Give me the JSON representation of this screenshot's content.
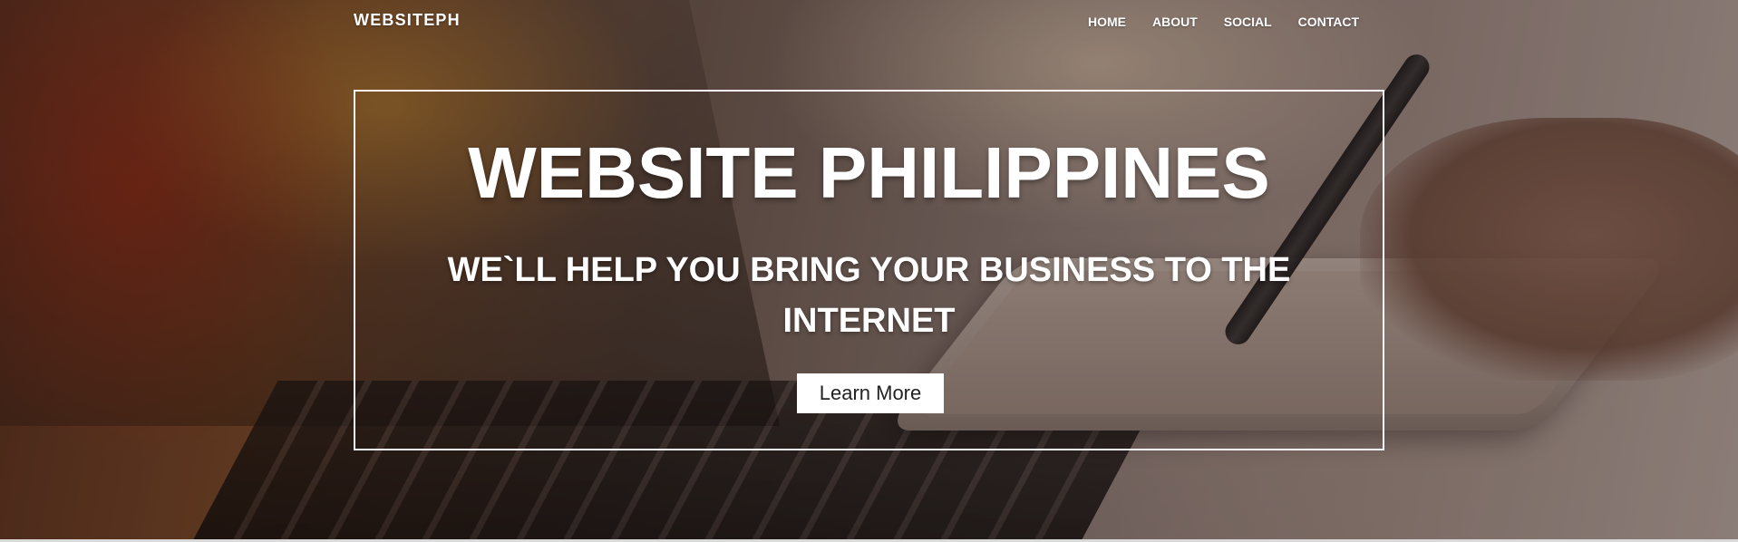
{
  "nav": {
    "brand": "WEBSITEPH",
    "items": [
      {
        "label": "HOME"
      },
      {
        "label": "ABOUT"
      },
      {
        "label": "SOCIAL"
      },
      {
        "label": "CONTACT"
      }
    ]
  },
  "hero": {
    "title": "WEBSITE PHILIPPINES",
    "subtitle": "WE`LL HELP YOU BRING YOUR BUSINESS TO THE INTERNET",
    "cta_label": "Learn More"
  }
}
